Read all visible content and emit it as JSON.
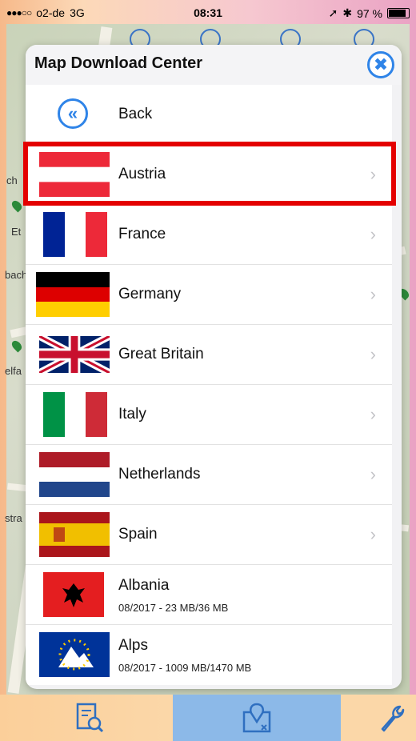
{
  "status_bar": {
    "signal_dots": "●●●○○",
    "carrier": "o2-de",
    "network": "3G",
    "time": "08:31",
    "battery": "97 %",
    "battery_level": 0.97
  },
  "map_labels": [
    "ch",
    "Et",
    "bach",
    "elfa",
    "stra"
  ],
  "dialog": {
    "title": "Map Download Center",
    "close_icon": "✖",
    "back": {
      "label": "Back",
      "icon": "«"
    },
    "rows": [
      {
        "label": "Austria",
        "flag": "austria-flag",
        "has_chevron": true,
        "highlighted": true
      },
      {
        "label": "France",
        "flag": "france-flag",
        "has_chevron": true
      },
      {
        "label": "Germany",
        "flag": "germany-flag",
        "has_chevron": true
      },
      {
        "label": "Great Britain",
        "flag": "great-britain-flag",
        "has_chevron": true
      },
      {
        "label": "Italy",
        "flag": "italy-flag",
        "has_chevron": true
      },
      {
        "label": "Netherlands",
        "flag": "netherlands-flag",
        "has_chevron": true
      },
      {
        "label": "Spain",
        "flag": "spain-flag",
        "has_chevron": true
      },
      {
        "label": "Albania",
        "flag": "albania-flag",
        "sub": "08/2017 - 23 MB/36 MB"
      },
      {
        "label": "Alps",
        "flag": "alps-flag",
        "sub": "08/2017 - 1009 MB/1470 MB"
      }
    ],
    "chevron": "›"
  },
  "bottom_bar": {
    "items": [
      {
        "icon": "search-document-icon"
      },
      {
        "icon": "map-download-icon",
        "active": true
      },
      {
        "icon": "wrench-icon"
      }
    ]
  },
  "colors": {
    "accent": "#2f84e8",
    "highlight": "#e40000"
  }
}
